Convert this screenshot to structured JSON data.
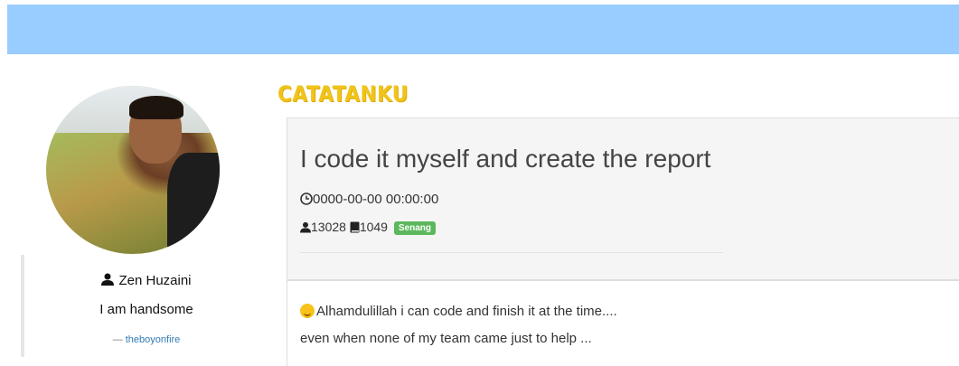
{
  "header": {
    "bar_color": "#99ccff"
  },
  "profile": {
    "name": "Zen Huzaini",
    "bio": "I am handsome",
    "cite_dash": "—",
    "cite": "theboyonfire"
  },
  "brand": {
    "logo_text": "CATATANKU",
    "logo_color": "#f0c41b"
  },
  "post": {
    "title": "I code it myself and create the report",
    "date": "0000-00-00 00:00:00",
    "views": "13028",
    "words": "1049",
    "mood": "Senang",
    "mood_color": "#5cb85c",
    "body_line1": "Alhamdulillah i can code and finish it at the time....",
    "body_line2": "even when none of my team came just to help ..."
  },
  "icons": [
    "user-icon",
    "clock-icon",
    "book-icon",
    "smile-emoji-icon"
  ]
}
